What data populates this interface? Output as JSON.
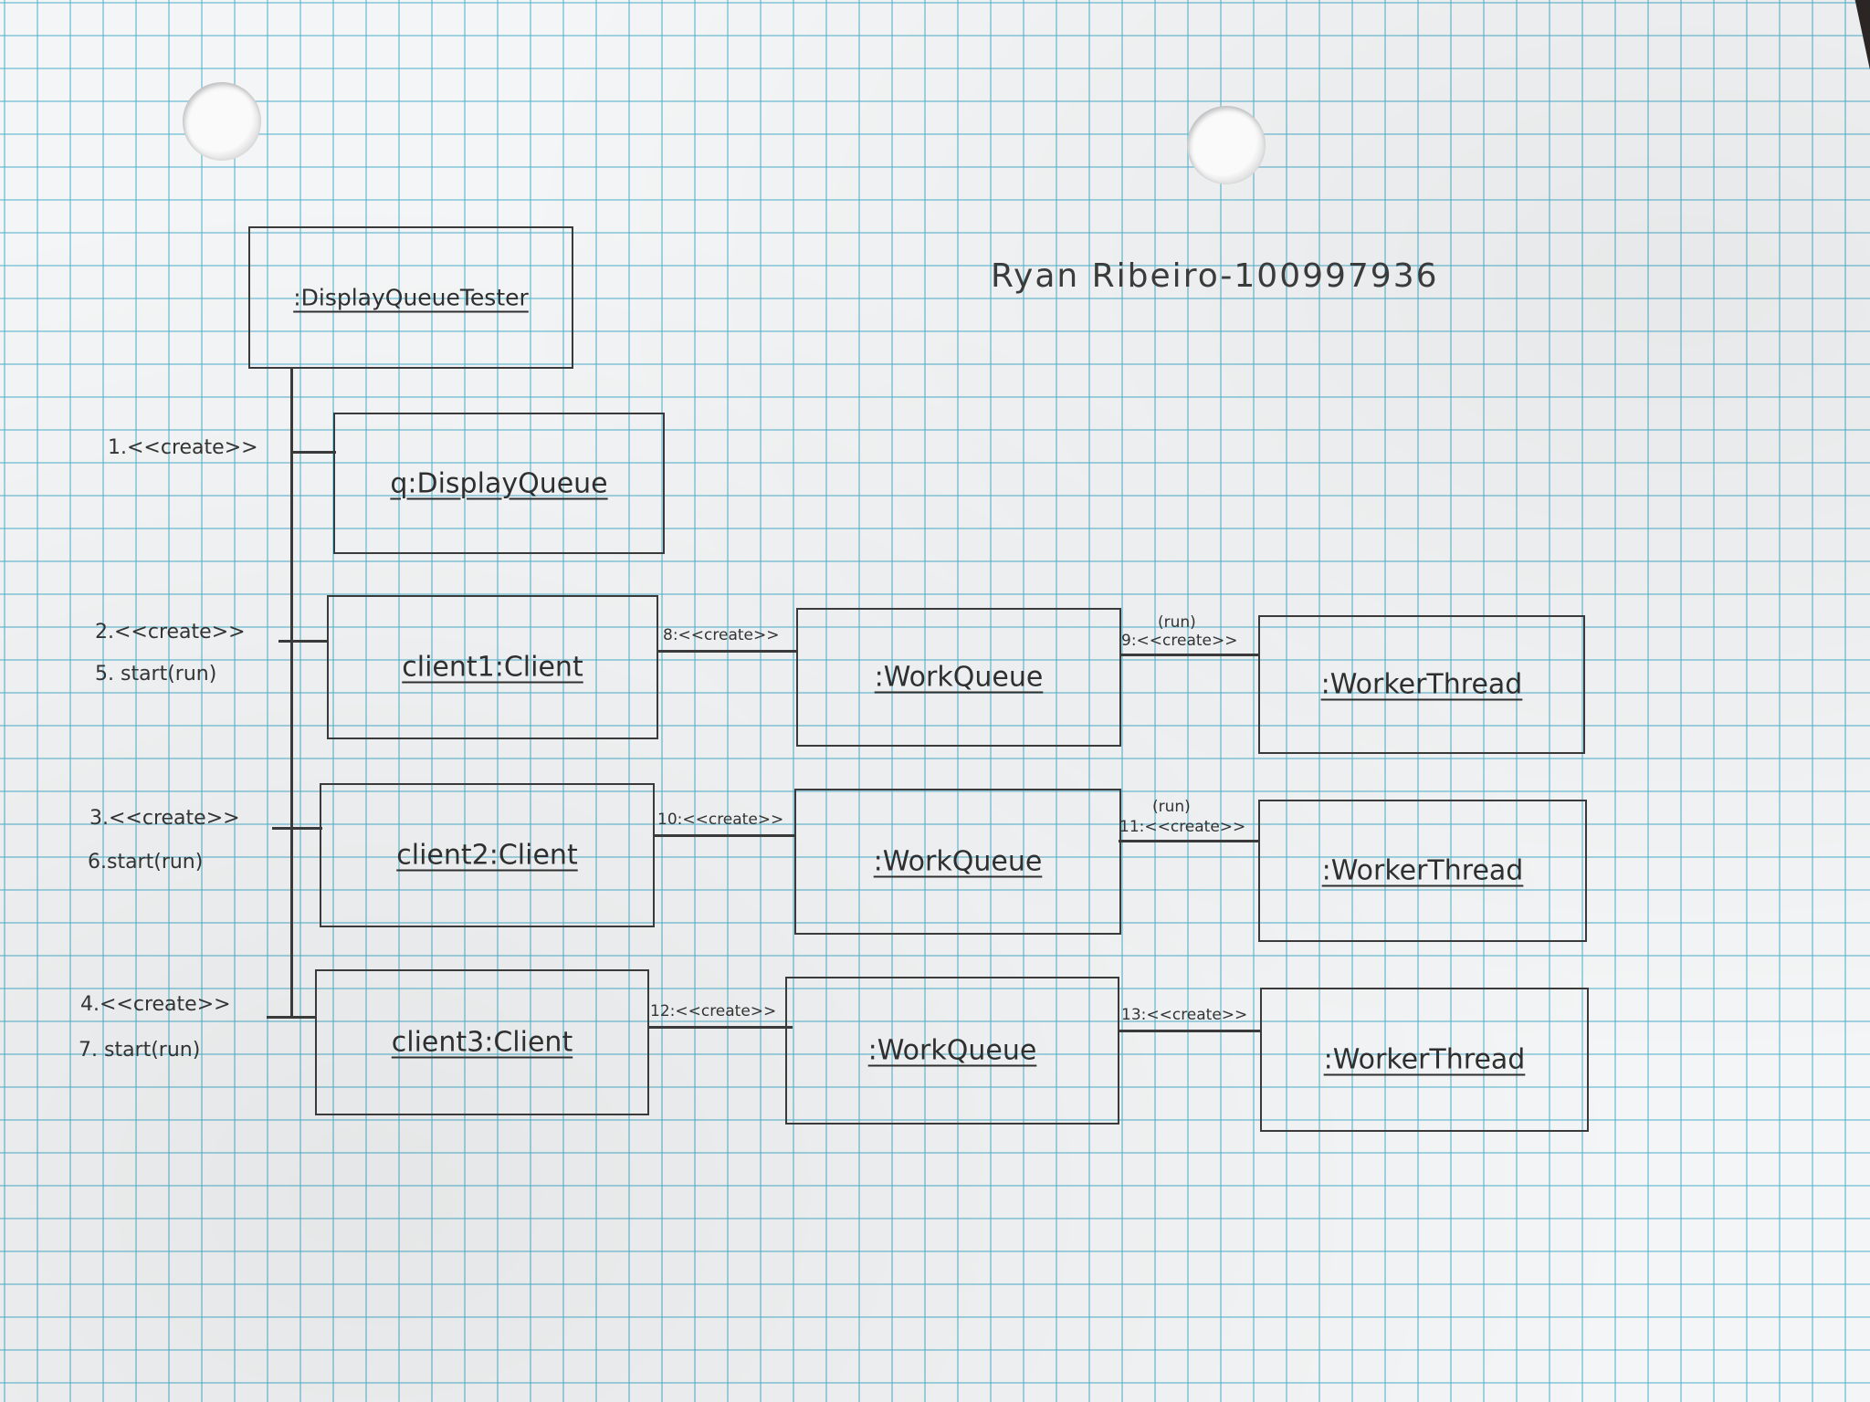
{
  "author": "Ryan Ribeiro-100997936",
  "objects": {
    "tester": ":DisplayQueueTester",
    "queue": "q:DisplayQueue",
    "client1": "client1:Client",
    "client2": "client2:Client",
    "client3": "client3:Client",
    "workqueue1": ":WorkQueue",
    "workqueue2": ":WorkQueue",
    "workqueue3": ":WorkQueue",
    "worker1": ":WorkerThread",
    "worker2": ":WorkerThread",
    "worker3": ":WorkerThread"
  },
  "messages": {
    "m1": "1.<<create>>",
    "m2": "2.<<create>>",
    "m5": "5. start(run)",
    "m3": "3.<<create>>",
    "m6": "6.start(run)",
    "m4": "4.<<create>>",
    "m7": "7. start(run)",
    "m8": "8:<<create>>",
    "m10": "10:<<create>>",
    "m12": "12:<<create>>",
    "run1": "(run)",
    "m9": "9:<<create>>",
    "run2": "(run)",
    "m11": "11:<<create>>",
    "m13": "13:<<create>>"
  }
}
